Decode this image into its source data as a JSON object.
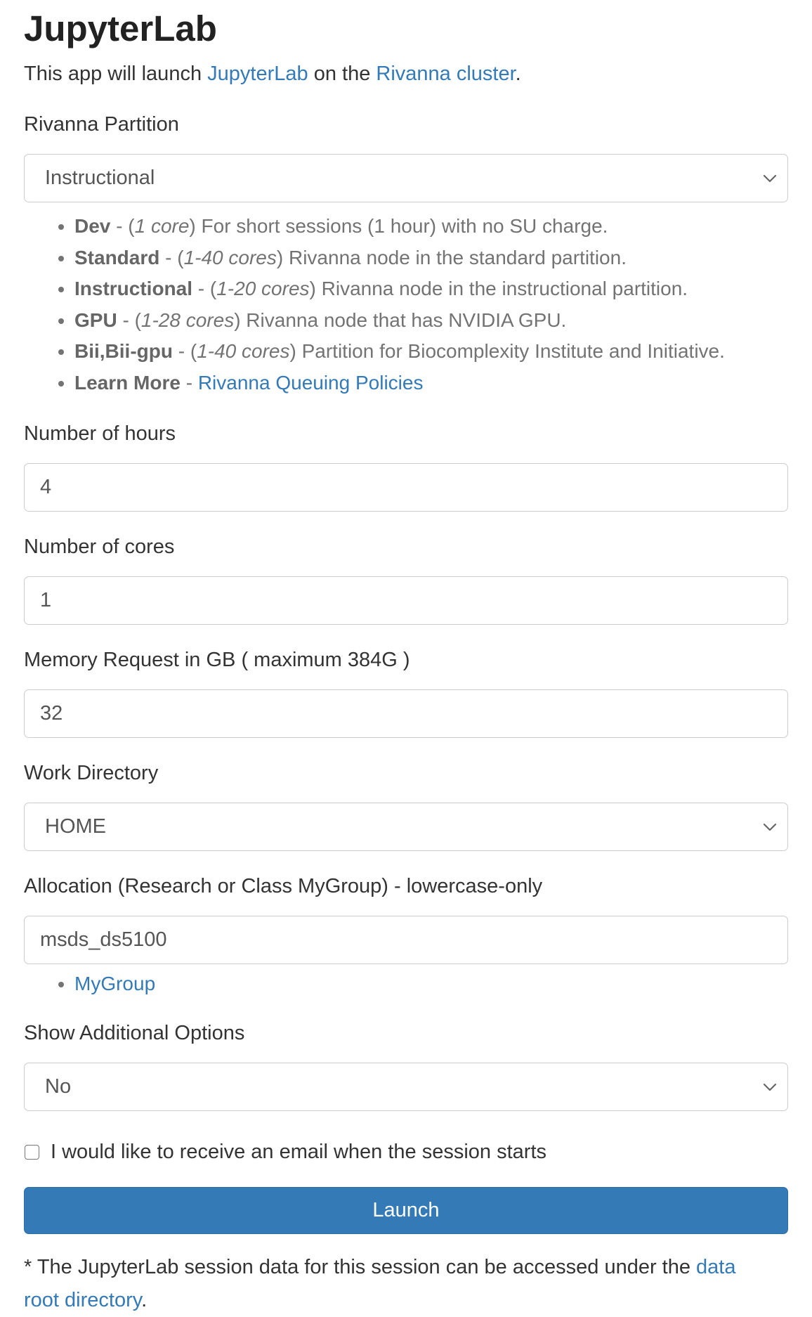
{
  "title": "JupyterLab",
  "intro": {
    "prefix": "This app will launch ",
    "link1": "JupyterLab",
    "middle": " on the ",
    "link2": "Rivanna cluster",
    "suffix": "."
  },
  "partition": {
    "label": "Rivanna Partition",
    "selected": "Instructional",
    "help": [
      {
        "name": "Dev",
        "sep": " - (",
        "cores": "1 core",
        "close": ")",
        "desc": " For short sessions (1 hour) with no SU charge."
      },
      {
        "name": "Standard",
        "sep": " - (",
        "cores": "1-40 cores",
        "close": ")",
        "desc": " Rivanna node in the standard partition."
      },
      {
        "name": "Instructional",
        "sep": " - (",
        "cores": "1-20 cores",
        "close": ")",
        "desc": " Rivanna node in the instructional partition."
      },
      {
        "name": "GPU",
        "sep": " - (",
        "cores": "1-28 cores",
        "close": ")",
        "desc": " Rivanna node that has NVIDIA GPU."
      },
      {
        "name": "Bii,Bii-gpu",
        "sep": " - (",
        "cores": "1-40 cores",
        "close": ")",
        "desc": " Partition for Biocomplexity Institute and Initiative."
      }
    ],
    "learn_more": {
      "name": "Learn More",
      "sep": " - ",
      "link": "Rivanna Queuing Policies"
    }
  },
  "hours": {
    "label": "Number of hours",
    "value": "4"
  },
  "cores": {
    "label": "Number of cores",
    "value": "1"
  },
  "memory": {
    "label": "Memory Request in GB ( maximum 384G )",
    "value": "32"
  },
  "workdir": {
    "label": "Work Directory",
    "selected": "HOME"
  },
  "allocation": {
    "label": "Allocation (Research or Class MyGroup) - lowercase-only",
    "value": "msds_ds5100",
    "help_link": "MyGroup"
  },
  "additional": {
    "label": "Show Additional Options",
    "selected": "No"
  },
  "email": {
    "label": "I would like to receive an email when the session starts",
    "checked": false
  },
  "launch": {
    "label": "Launch"
  },
  "footnote": {
    "text": "* The JupyterLab session data for this session can be accessed under the ",
    "link": "data root directory",
    "suffix": "."
  },
  "colors": {
    "link": "#337ab7",
    "button": "#337ab7",
    "text": "#333333",
    "help": "#737373"
  },
  "icons": {
    "select": "chevron-down-icon"
  }
}
